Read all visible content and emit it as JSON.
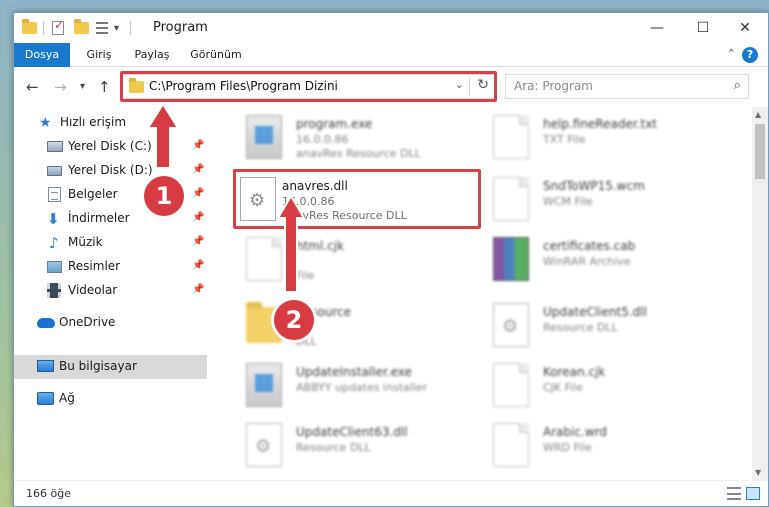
{
  "window": {
    "title": "Program",
    "quick_access_dropdown": "▾"
  },
  "window_controls": {
    "minimize": "—",
    "maximize": "☐",
    "close": "✕"
  },
  "ribbon": {
    "tabs": [
      "Dosya",
      "Giriş",
      "Paylaş",
      "Görünüm"
    ],
    "collapse": "⌃",
    "help": "?"
  },
  "nav": {
    "back": "←",
    "forward": "→",
    "recent": "▾",
    "up": "↑",
    "address": "C:\\Program Files\\Program Dizini",
    "address_dropdown": "⌄",
    "refresh": "↻",
    "search_placeholder": "Ara: Program",
    "search_icon": "⌕"
  },
  "sidebar": {
    "items": [
      {
        "label": "Hızlı erişim",
        "icon": "star-icon",
        "glyph": "★"
      },
      {
        "label": "Yerel Disk (C:)",
        "icon": "drive-icon",
        "pinned": true
      },
      {
        "label": "Yerel Disk (D:)",
        "icon": "drive-icon",
        "pinned": true
      },
      {
        "label": "Belgeler",
        "icon": "documents-icon",
        "pinned": true
      },
      {
        "label": "İndirmeler",
        "icon": "download-icon",
        "glyph": "⬇",
        "pinned": true
      },
      {
        "label": "Müzik",
        "icon": "music-icon",
        "glyph": "♪",
        "pinned": true
      },
      {
        "label": "Resimler",
        "icon": "pictures-icon",
        "pinned": true
      },
      {
        "label": "Videolar",
        "icon": "videos-icon",
        "pinned": true
      },
      {
        "label": "OneDrive",
        "icon": "cloud-icon"
      },
      {
        "label": "Bu bilgisayar",
        "icon": "computer-icon",
        "selected": true
      },
      {
        "label": "Ağ",
        "icon": "network-icon"
      }
    ],
    "pin_glyph": "📌"
  },
  "files": {
    "left": [
      {
        "name": "program.exe",
        "line1": "16.0.0.86",
        "line2": "anavRes Resource DLL",
        "icon": "exe",
        "blurred": true
      },
      {
        "name": "anavres.dll",
        "line1": "16.0.0.86",
        "line2": "anavRes Resource DLL",
        "icon": "gear",
        "blurred": false
      },
      {
        "name": "html.cjk",
        "line1": "",
        "line2": "File",
        "icon": "generic",
        "blurred": true
      },
      {
        "name": "Resource",
        "line1": "16",
        "line2": "DLL",
        "icon": "folder",
        "blurred": true
      },
      {
        "name": "UpdateInstaller.exe",
        "line1": "ABBYY updates installer",
        "line2": "",
        "icon": "exe",
        "blurred": true
      },
      {
        "name": "UpdateClient63.dll",
        "line1": "Resource DLL",
        "line2": "",
        "icon": "gear",
        "blurred": true
      }
    ],
    "right": [
      {
        "name": "help.fineReader.txt",
        "line1": "TXT File",
        "line2": "",
        "icon": "generic",
        "blurred": true
      },
      {
        "name": "SndToWP15.wcm",
        "line1": "WCM File",
        "line2": "",
        "icon": "generic",
        "blurred": true
      },
      {
        "name": "certificates.cab",
        "line1": "WinRAR Archive",
        "line2": "",
        "icon": "rar",
        "blurred": true
      },
      {
        "name": "UpdateClient5.dll",
        "line1": "Resource DLL",
        "line2": "",
        "icon": "gear",
        "blurred": true
      },
      {
        "name": "Korean.cjk",
        "line1": "CJK File",
        "line2": "",
        "icon": "generic",
        "blurred": true
      },
      {
        "name": "Arabic.wrd",
        "line1": "WRD File",
        "line2": "",
        "icon": "generic",
        "blurred": true
      }
    ],
    "gear_glyph": "⚙"
  },
  "scrollbar": {
    "up": "▲",
    "down": "▼"
  },
  "status": {
    "count": "166 öğe"
  },
  "annotations": {
    "badge1": "1",
    "badge2": "2"
  },
  "colors": {
    "accent": "#1979ca",
    "highlight": "#d9414a"
  }
}
